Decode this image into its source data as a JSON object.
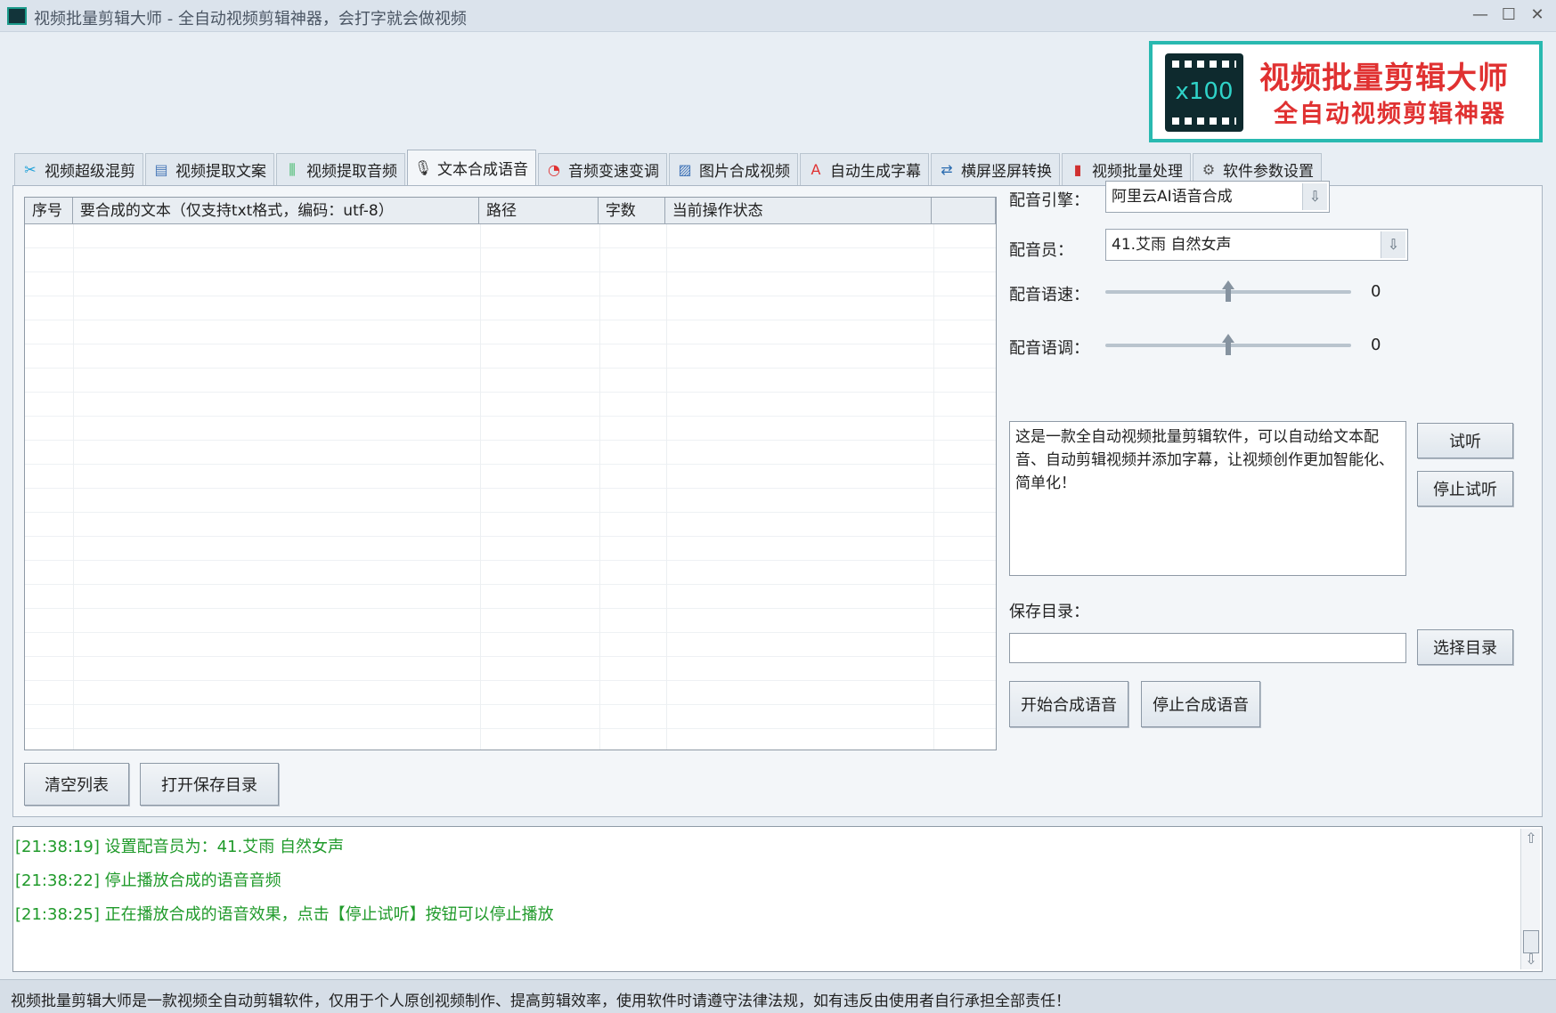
{
  "window": {
    "title": "视频批量剪辑大师 - 全自动视频剪辑神器，会打字就会做视频",
    "controls": [
      "—",
      "☐",
      "✕"
    ]
  },
  "banner": {
    "logo_text": "x100",
    "title": "视频批量剪辑大师",
    "subtitle": "全自动视频剪辑神器"
  },
  "tabs": [
    {
      "label": "视频超级混剪",
      "icon": "scissors-icon",
      "glyph": "✂",
      "color": "#1a9fd8"
    },
    {
      "label": "视频提取文案",
      "icon": "document-icon",
      "glyph": "▤",
      "color": "#4a79b8"
    },
    {
      "label": "视频提取音频",
      "icon": "waveform-icon",
      "glyph": "⫼",
      "color": "#2fb55a"
    },
    {
      "label": "文本合成语音",
      "icon": "microphone-icon",
      "glyph": "🎙",
      "color": "#333333"
    },
    {
      "label": "音频变速变调",
      "icon": "speedometer-icon",
      "glyph": "◔",
      "color": "#e03131"
    },
    {
      "label": "图片合成视频",
      "icon": "picture-icon",
      "glyph": "▨",
      "color": "#3a6fb5"
    },
    {
      "label": "自动生成字幕",
      "icon": "font-icon",
      "glyph": "A",
      "color": "#e03131"
    },
    {
      "label": "横屏竖屏转换",
      "icon": "rotate-screen-icon",
      "glyph": "⇄",
      "color": "#2b6cb0"
    },
    {
      "label": "视频批量处理",
      "icon": "film-icon",
      "glyph": "▮",
      "color": "#d03030"
    },
    {
      "label": "软件参数设置",
      "icon": "gear-icon",
      "glyph": "⚙",
      "color": "#555555"
    }
  ],
  "active_tab": 3,
  "table": {
    "columns": [
      "序号",
      "要合成的文本（仅支持txt格式，编码：utf-8）",
      "路径",
      "字数",
      "当前操作状态",
      ""
    ],
    "rows": []
  },
  "buttons": {
    "clear_list": "清空列表",
    "open_save_dir": "打开保存目录",
    "preview": "试听",
    "stop_preview": "停止试听",
    "choose_dir": "选择目录",
    "start_synthesis": "开始合成语音",
    "stop_synthesis": "停止合成语音"
  },
  "settings": {
    "engine_label": "配音引擎：",
    "engine_value": "阿里云AI语音合成",
    "voice_label": "配音员：",
    "voice_value": "41.艾雨 自然女声",
    "speed_label": "配音语速：",
    "speed_value": 0,
    "pitch_label": "配音语调：",
    "pitch_value": 0,
    "sample_text": "这是一款全自动视频批量剪辑软件，可以自动给文本配音、自动剪辑视频并添加字幕，让视频创作更加智能化、简单化！",
    "save_dir_label": "保存目录：",
    "save_dir_value": ""
  },
  "log": [
    "[21:38:19] 设置配音员为：41.艾雨 自然女声",
    "[21:38:22] 停止播放合成的语音音频",
    "[21:38:25] 正在播放合成的语音效果，点击【停止试听】按钮可以停止播放"
  ],
  "status": "视频批量剪辑大师是一款视频全自动剪辑软件，仅用于个人原创视频制作、提高剪辑效率，使用软件时请遵守法律法规，如有违反由使用者自行承担全部责任！"
}
